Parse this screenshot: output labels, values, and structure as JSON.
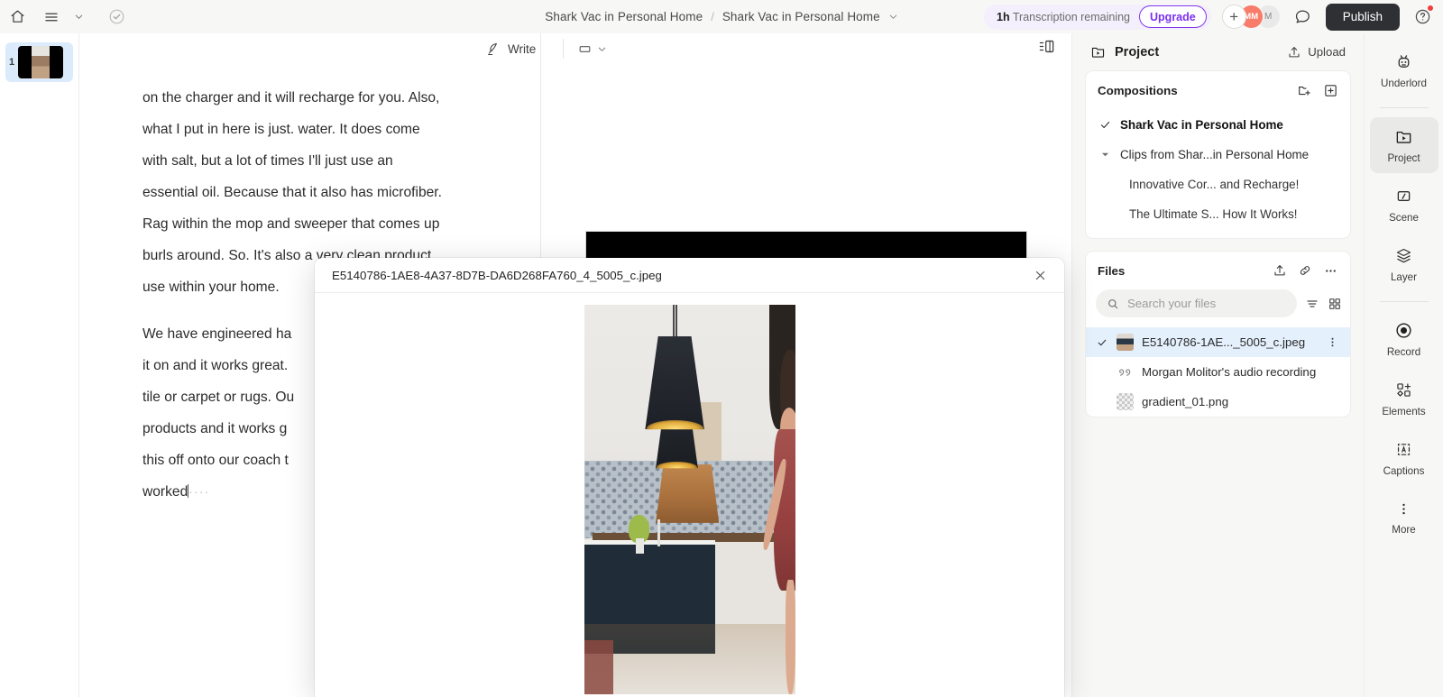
{
  "topbar": {
    "home_icon": "home-icon",
    "menu_icon": "hamburger-menu-icon",
    "menu_caret_icon": "chevron-down-icon",
    "check_icon": "check-circle-icon",
    "breadcrumb": {
      "parent": "Shark Vac in Personal Home",
      "separator": "/",
      "current": "Shark Vac in Personal Home",
      "caret_icon": "chevron-down-icon"
    },
    "transcription": {
      "amount": "1h",
      "label": "Transcription remaining",
      "upgrade_label": "Upgrade",
      "upgrade_color": "#7b2ff2",
      "pill_bg": "#f4effc"
    },
    "avatars": [
      {
        "name": "add-collaborator",
        "label": "+",
        "color": "#ffffff"
      },
      {
        "name": "avatar-mm",
        "label": "MM",
        "color": "#f97b6a"
      },
      {
        "name": "avatar-m",
        "label": "M",
        "color": "#e9e9e9"
      }
    ],
    "comment_icon": "comment-bubble-icon",
    "publish_label": "Publish",
    "publish_bg": "#2f3033",
    "help_icon": "help-question-icon",
    "help_badge_color": "#f03e3e"
  },
  "filmstrip": {
    "items": [
      {
        "number": "1",
        "name": "scene-thumbnail-1"
      }
    ]
  },
  "transcript": {
    "lines": [
      "on the charger and it will recharge for you. Also,",
      "what I put in here is just.   water. It does come",
      "with salt, but a lot of times I'll just use an",
      "essential oil. Because that it also has microfiber.",
      "Rag within the mop and sweeper that comes up",
      "burls around. So.    It's also a very clean product",
      "use within your home."
    ],
    "lines2": [
      "We have engineered ha",
      "it on and it works great.",
      "tile or carpet or rugs. Ou",
      "products and it works g",
      "this off onto our coach t",
      "worked"
    ]
  },
  "editor": {
    "write_label": "Write",
    "write_icon": "quill-pen-icon",
    "aspect_icon": "aspect-ratio-icon",
    "aspect_caret_icon": "chevron-down-icon",
    "layout_icon": "panel-layout-icon",
    "canvas_bg": "#000000"
  },
  "project_panel": {
    "header": {
      "icon": "project-folder-play-icon",
      "title": "Project",
      "upload_label": "Upload",
      "upload_icon": "upload-icon"
    },
    "compositions": {
      "title": "Compositions",
      "new_folder_icon": "new-folder-icon",
      "add_icon": "plus-square-icon",
      "items": [
        {
          "label": "Shark Vac in Personal Home",
          "mark": "check",
          "level": 0,
          "selected": true
        },
        {
          "label": "Clips from Shar...in Personal Home",
          "mark": "caret",
          "level": 0,
          "selected": false
        },
        {
          "label": "Innovative Cor... and Recharge!",
          "mark": "none",
          "level": 1,
          "selected": false
        },
        {
          "label": "The Ultimate S... How It Works!",
          "mark": "none",
          "level": 1,
          "selected": false
        }
      ]
    },
    "files": {
      "title": "Files",
      "upload_icon": "upload-icon",
      "link_icon": "link-icon",
      "more_icon": "ellipsis-horizontal-icon",
      "search_placeholder": "Search your files",
      "search_value": "",
      "search_icon": "search-icon",
      "sort_icon": "sort-icon",
      "grid_icon": "grid-view-icon",
      "items": [
        {
          "name": "E5140786-1AE..._5005_c.jpeg",
          "type": "image",
          "selected": true,
          "more_icon": "ellipsis-vertical-icon"
        },
        {
          "name": "Morgan Molitor's audio recording",
          "type": "audio",
          "selected": false
        },
        {
          "name": "gradient_01.png",
          "type": "gradient",
          "selected": false
        }
      ],
      "selected_bg": "#e4f0fc"
    }
  },
  "rail": {
    "items": [
      {
        "label": "Underlord",
        "icon": "robot-underlord-icon",
        "active": false,
        "sep_after": true
      },
      {
        "label": "Project",
        "icon": "project-folder-play-icon",
        "active": true,
        "sep_after": false
      },
      {
        "label": "Scene",
        "icon": "scene-slash-icon",
        "active": false,
        "sep_after": false
      },
      {
        "label": "Layer",
        "icon": "layers-stack-icon",
        "active": false,
        "sep_after": true
      },
      {
        "label": "Record",
        "icon": "record-circle-icon",
        "active": false,
        "sep_after": false
      },
      {
        "label": "Elements",
        "icon": "elements-add-icon",
        "active": false,
        "sep_after": false
      },
      {
        "label": "Captions",
        "icon": "captions-text-icon",
        "active": false,
        "sep_after": false
      },
      {
        "label": "More",
        "icon": "ellipsis-vertical-icon",
        "active": false,
        "sep_after": false
      }
    ]
  },
  "modal": {
    "title": "E5140786-1AE8-4A37-8D7B-DA6D268FA760_4_5005_c.jpeg",
    "close_icon": "close-x-icon",
    "preview_name": "kitchen-photo-preview"
  }
}
